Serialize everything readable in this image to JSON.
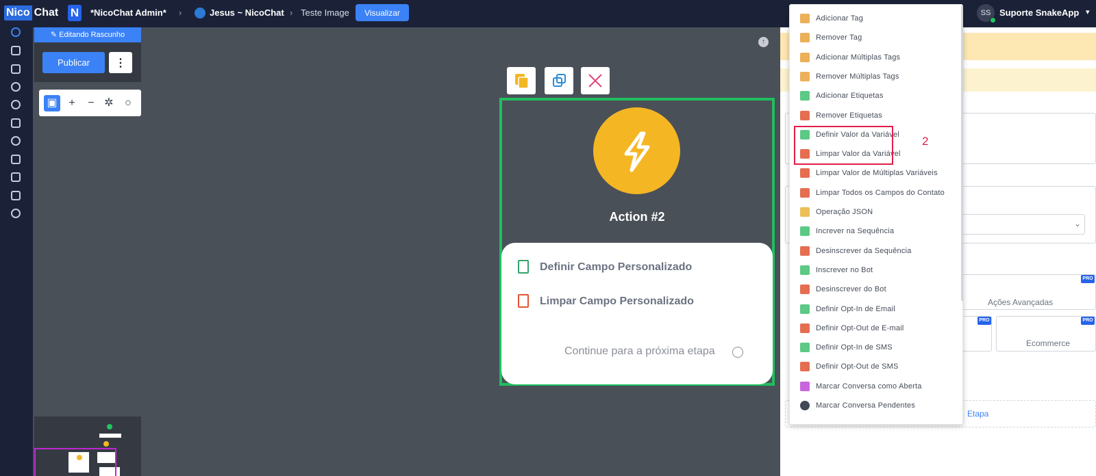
{
  "topbar": {
    "logo_part1": "Nico",
    "logo_part2": "Chat",
    "app_letter": "N",
    "workspace": "*NicoChat Admin*",
    "flow_name": "Jesus ~ NicoChat",
    "subflow": "Teste Image",
    "preview_label": "Visualizar",
    "avatar_initials": "SS",
    "user_name": "Suporte SnakeApp"
  },
  "left_panel": {
    "draft_label": "Editando Rascunho",
    "publish_label": "Publicar",
    "more_label": "⋮"
  },
  "node": {
    "title": "Action #2",
    "actions": [
      {
        "label": "Definir Campo Personalizado",
        "icon": "file-import-icon",
        "color": "#34a36b"
      },
      {
        "label": "Limpar Campo Personalizado",
        "icon": "file-clear-icon",
        "color": "#e05532"
      }
    ],
    "continue_label": "Continue para a próxima etapa"
  },
  "right_panel": {
    "advanced_actions_label": "Ações Avançadas",
    "ecommerce_label": "Ecommerce",
    "step_link": "Etapa",
    "pro_badge": "PRO"
  },
  "dropdown": {
    "items": [
      {
        "label": "Adicionar Tag",
        "color": "#e9a23b"
      },
      {
        "label": "Remover Tag",
        "color": "#e9a23b"
      },
      {
        "label": "Adicionar Múltiplas Tags",
        "color": "#e9a23b"
      },
      {
        "label": "Remover Múltiplas Tags",
        "color": "#e9a23b"
      },
      {
        "label": "Adicionar Etiquetas",
        "color": "#3fbf6f"
      },
      {
        "label": "Remover Etiquetas",
        "color": "#e05532"
      },
      {
        "label": "Definir Valor da Variável",
        "color": "#3fbf6f"
      },
      {
        "label": "Limpar Valor da Variável",
        "color": "#e05532"
      },
      {
        "label": "Limpar Valor de Múltiplas Variáveis",
        "color": "#e05532"
      },
      {
        "label": "Limpar Todos os Campos do Contato",
        "color": "#e05532"
      },
      {
        "label": "Operação JSON",
        "color": "#e9b43b"
      },
      {
        "label": "Increver na Sequência",
        "color": "#3fbf6f"
      },
      {
        "label": "Desinscrever da Sequência",
        "color": "#e05532"
      },
      {
        "label": "Inscrever no Bot",
        "color": "#3fbf6f"
      },
      {
        "label": "Desinscrever do Bot",
        "color": "#e05532"
      },
      {
        "label": "Definir Opt-In de Email",
        "color": "#3fbf6f"
      },
      {
        "label": "Definir Opt-Out de E-mail",
        "color": "#e05532"
      },
      {
        "label": "Definir Opt-In de SMS",
        "color": "#3fbf6f"
      },
      {
        "label": "Definir Opt-Out de SMS",
        "color": "#e05532"
      },
      {
        "label": "Marcar Conversa como Aberta",
        "color": "#c04ad6"
      },
      {
        "label": "Marcar Conversa Pendentes",
        "color": "#1f2937"
      }
    ],
    "annotation_number": "2"
  },
  "colors": {
    "topbar_bg": "#1b2238",
    "accent": "#3b82f6",
    "node_border": "#1fbf5f",
    "bolt_yellow": "#f5b624",
    "highlight_red": "#e11d48"
  }
}
